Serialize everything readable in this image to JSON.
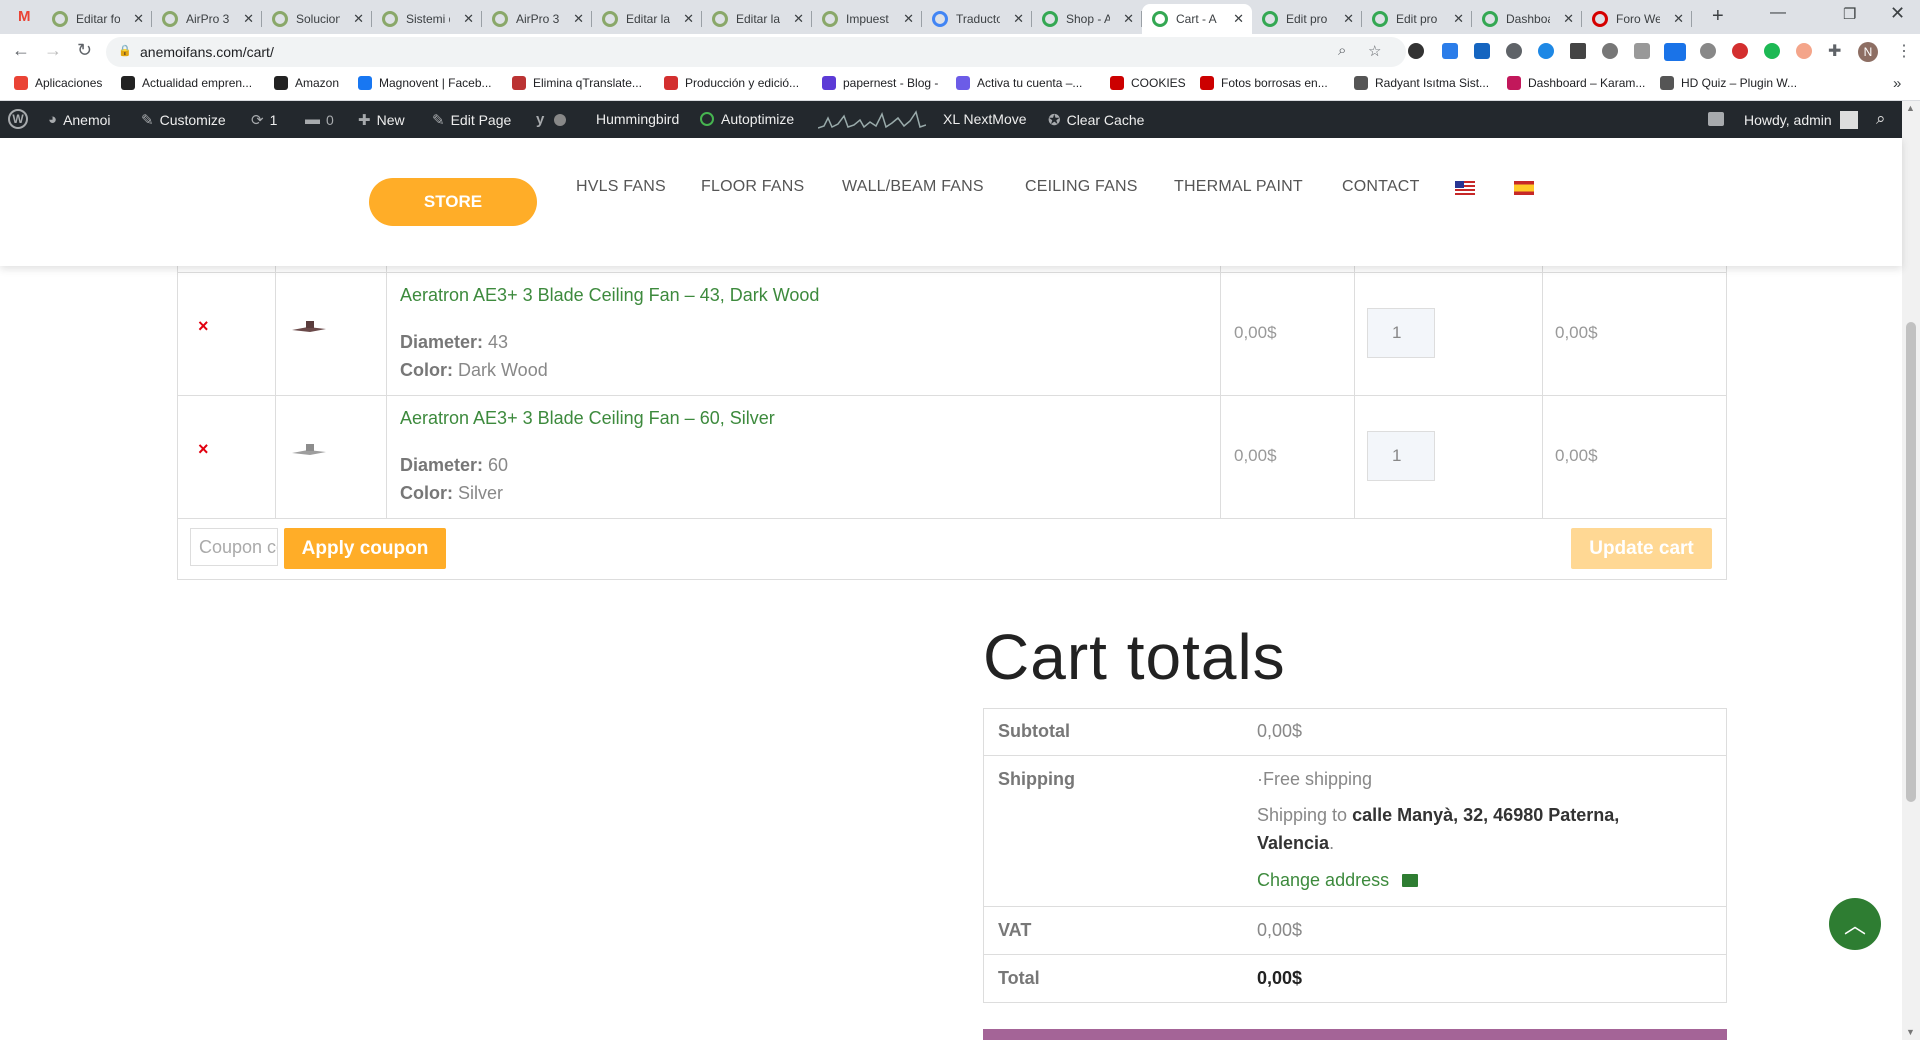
{
  "browser": {
    "tabs": [
      {
        "title": "Editar fo",
        "fav": "#8aa86a"
      },
      {
        "title": "AirPro 3",
        "fav": "#8aa86a"
      },
      {
        "title": "Solucion",
        "fav": "#8aa86a"
      },
      {
        "title": "Sistemi d",
        "fav": "#8aa86a"
      },
      {
        "title": "AirPro 3",
        "fav": "#8aa86a"
      },
      {
        "title": "Editar la",
        "fav": "#8aa86a"
      },
      {
        "title": "Editar la",
        "fav": "#8aa86a"
      },
      {
        "title": "Impuest",
        "fav": "#8aa86a"
      },
      {
        "title": "Traducto",
        "fav": "#4285f4"
      },
      {
        "title": "Shop - A",
        "fav": "#34a853"
      },
      {
        "title": "Cart - A",
        "fav": "#34a853"
      },
      {
        "title": "Edit pro",
        "fav": "#34a853"
      },
      {
        "title": "Edit pro",
        "fav": "#34a853"
      },
      {
        "title": "Dashboa",
        "fav": "#34a853"
      },
      {
        "title": "Foro We",
        "fav": "#d50000"
      }
    ],
    "new_tab": "+",
    "url": "anemoifans.com/cart/",
    "profile_initial": "N",
    "bookmarks": [
      {
        "label": "Aplicaciones",
        "color": "#ea4335"
      },
      {
        "label": "Actualidad empren...",
        "color": "#222"
      },
      {
        "label": "Amazon",
        "color": "#222"
      },
      {
        "label": "Magnovent | Faceb...",
        "color": "#1877f2"
      },
      {
        "label": "Elimina qTranslate...",
        "color": "#b33"
      },
      {
        "label": "Producción y edició...",
        "color": "#d32f2f"
      },
      {
        "label": "papernest - Blog -",
        "color": "#5c3bd6"
      },
      {
        "label": "Activa tu cuenta –...",
        "color": "#6c5ce7"
      },
      {
        "label": "COOKIES",
        "color": "#c00"
      },
      {
        "label": "Fotos borrosas en...",
        "color": "#c00"
      },
      {
        "label": "Radyant Isıtma Sist...",
        "color": "#555"
      },
      {
        "label": "Dashboard – Karam...",
        "color": "#c2185b"
      },
      {
        "label": "HD Quiz – Plugin W...",
        "color": "#555"
      }
    ],
    "bookmarks_more": "»"
  },
  "admin_bar": {
    "site": "Anemoi",
    "customize": "Customize",
    "updates": "1",
    "comments": "0",
    "new": "New",
    "edit_page": "Edit Page",
    "hummingbird": "Hummingbird",
    "autoptimize": "Autoptimize",
    "nextmove": "XL NextMove",
    "clear_cache": "Clear Cache",
    "howdy": "Howdy, admin"
  },
  "header": {
    "store": "STORE",
    "nav": [
      "HVLS FANS",
      "FLOOR FANS",
      "WALL/BEAM FANS",
      "CEILING FANS",
      "THERMAL PAINT",
      "CONTACT"
    ]
  },
  "cart": {
    "items": [
      {
        "name": "Aeratron AE3+ 3 Blade Ceiling Fan – 43, Dark Wood",
        "diameter_label": "Diameter:",
        "diameter": "43",
        "color_label": "Color:",
        "color": "Dark Wood",
        "price": "0,00$",
        "qty": "1",
        "subtotal": "0,00$"
      },
      {
        "name": "Aeratron AE3+ 3 Blade Ceiling Fan – 60, Silver",
        "diameter_label": "Diameter:",
        "diameter": "60",
        "color_label": "Color:",
        "color": "Silver",
        "price": "0,00$",
        "qty": "1",
        "subtotal": "0,00$"
      }
    ],
    "remove_symbol": "×",
    "coupon_placeholder": "Coupon code",
    "apply_coupon": "Apply coupon",
    "update_cart": "Update cart"
  },
  "totals": {
    "title": "Cart totals",
    "subtotal_label": "Subtotal",
    "subtotal": "0,00$",
    "shipping_label": "Shipping",
    "shipping_method": "Free shipping",
    "shipping_to_prefix": "Shipping to",
    "shipping_address_1": "calle Manyà, 32, 46980 Paterna,",
    "shipping_address_2": "Valencia",
    "change_address": "Change address",
    "vat_label": "VAT",
    "vat": "0,00$",
    "total_label": "Total",
    "total": "0,00$"
  },
  "colors": {
    "accent": "#ffad28",
    "link": "#3d8a3d",
    "wp_bar": "#23282d",
    "checkout": "#a46497"
  }
}
